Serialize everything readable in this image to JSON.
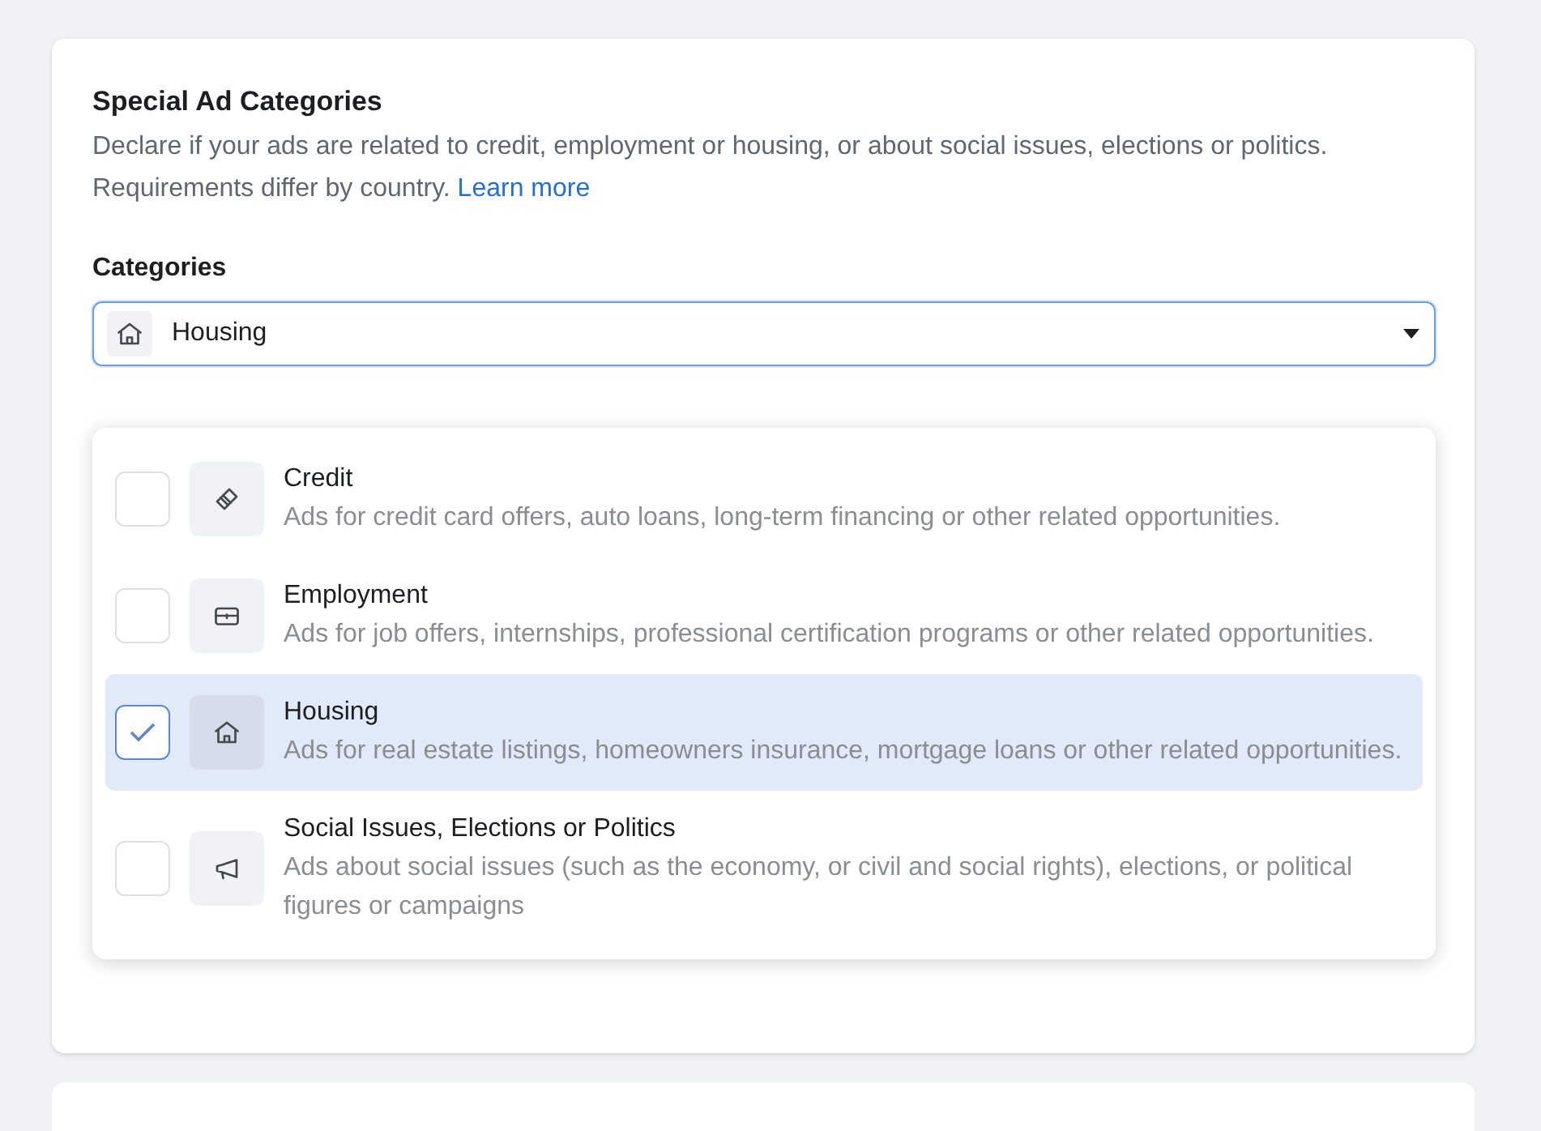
{
  "section": {
    "title": "Special Ad Categories",
    "description": "Declare if your ads are related to credit, employment or housing, or about social issues, elections or politics. Requirements differ by country.",
    "link": "Learn more"
  },
  "categories": {
    "label": "Categories",
    "value": "Housing",
    "expanded": true
  },
  "options": [
    {
      "label": "Credit",
      "description": "Ads for credit card offers, auto loans, long-term financing or other related opportunities.",
      "checked": false
    },
    {
      "label": "Employment",
      "description": "Ads for job offers, internships, professional certification programs or other related opportunities.",
      "checked": false
    },
    {
      "label": "Housing",
      "description": "Ads for real estate listings, homeowners insurance, mortgage loans or other related opportunities.",
      "checked": true
    },
    {
      "label": "Social Issues, Elections or Politics",
      "description": "Ads about social issues (such as the economy, or civil and social rights), elections, or political figures or campaigns",
      "checked": false
    }
  ]
}
